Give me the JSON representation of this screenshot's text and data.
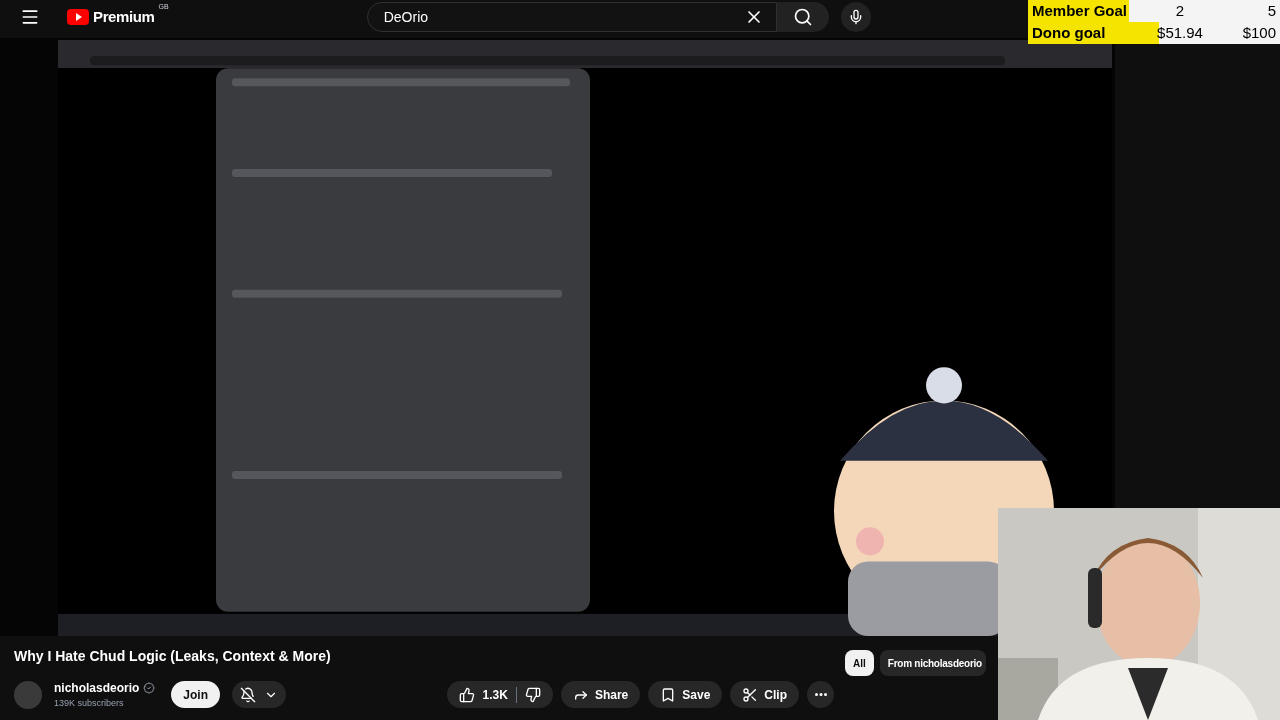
{
  "masthead": {
    "logo": "Premium",
    "region": "GB",
    "search": {
      "value": "DeOrio"
    }
  },
  "overlay_goals": [
    {
      "label": "Member Goal",
      "current": "2",
      "target": "5",
      "level": 0.4
    },
    {
      "label": "Dono goal",
      "current": "$51.94",
      "target": "$100",
      "level": 0.52
    }
  ],
  "title": "Why I Hate Chud Logic (Leaks, Context & More)",
  "channel": {
    "name": "nicholasdeorio",
    "verified": true,
    "subscribers": "139K subscribers",
    "join": "Join"
  },
  "actions": {
    "likes": "1.3K",
    "share": "Share",
    "save": "Save",
    "clip": "Clip"
  },
  "chips": [
    {
      "label": "All",
      "selected": true
    },
    {
      "label": "From nicholasdeorio",
      "selected": false
    }
  ]
}
